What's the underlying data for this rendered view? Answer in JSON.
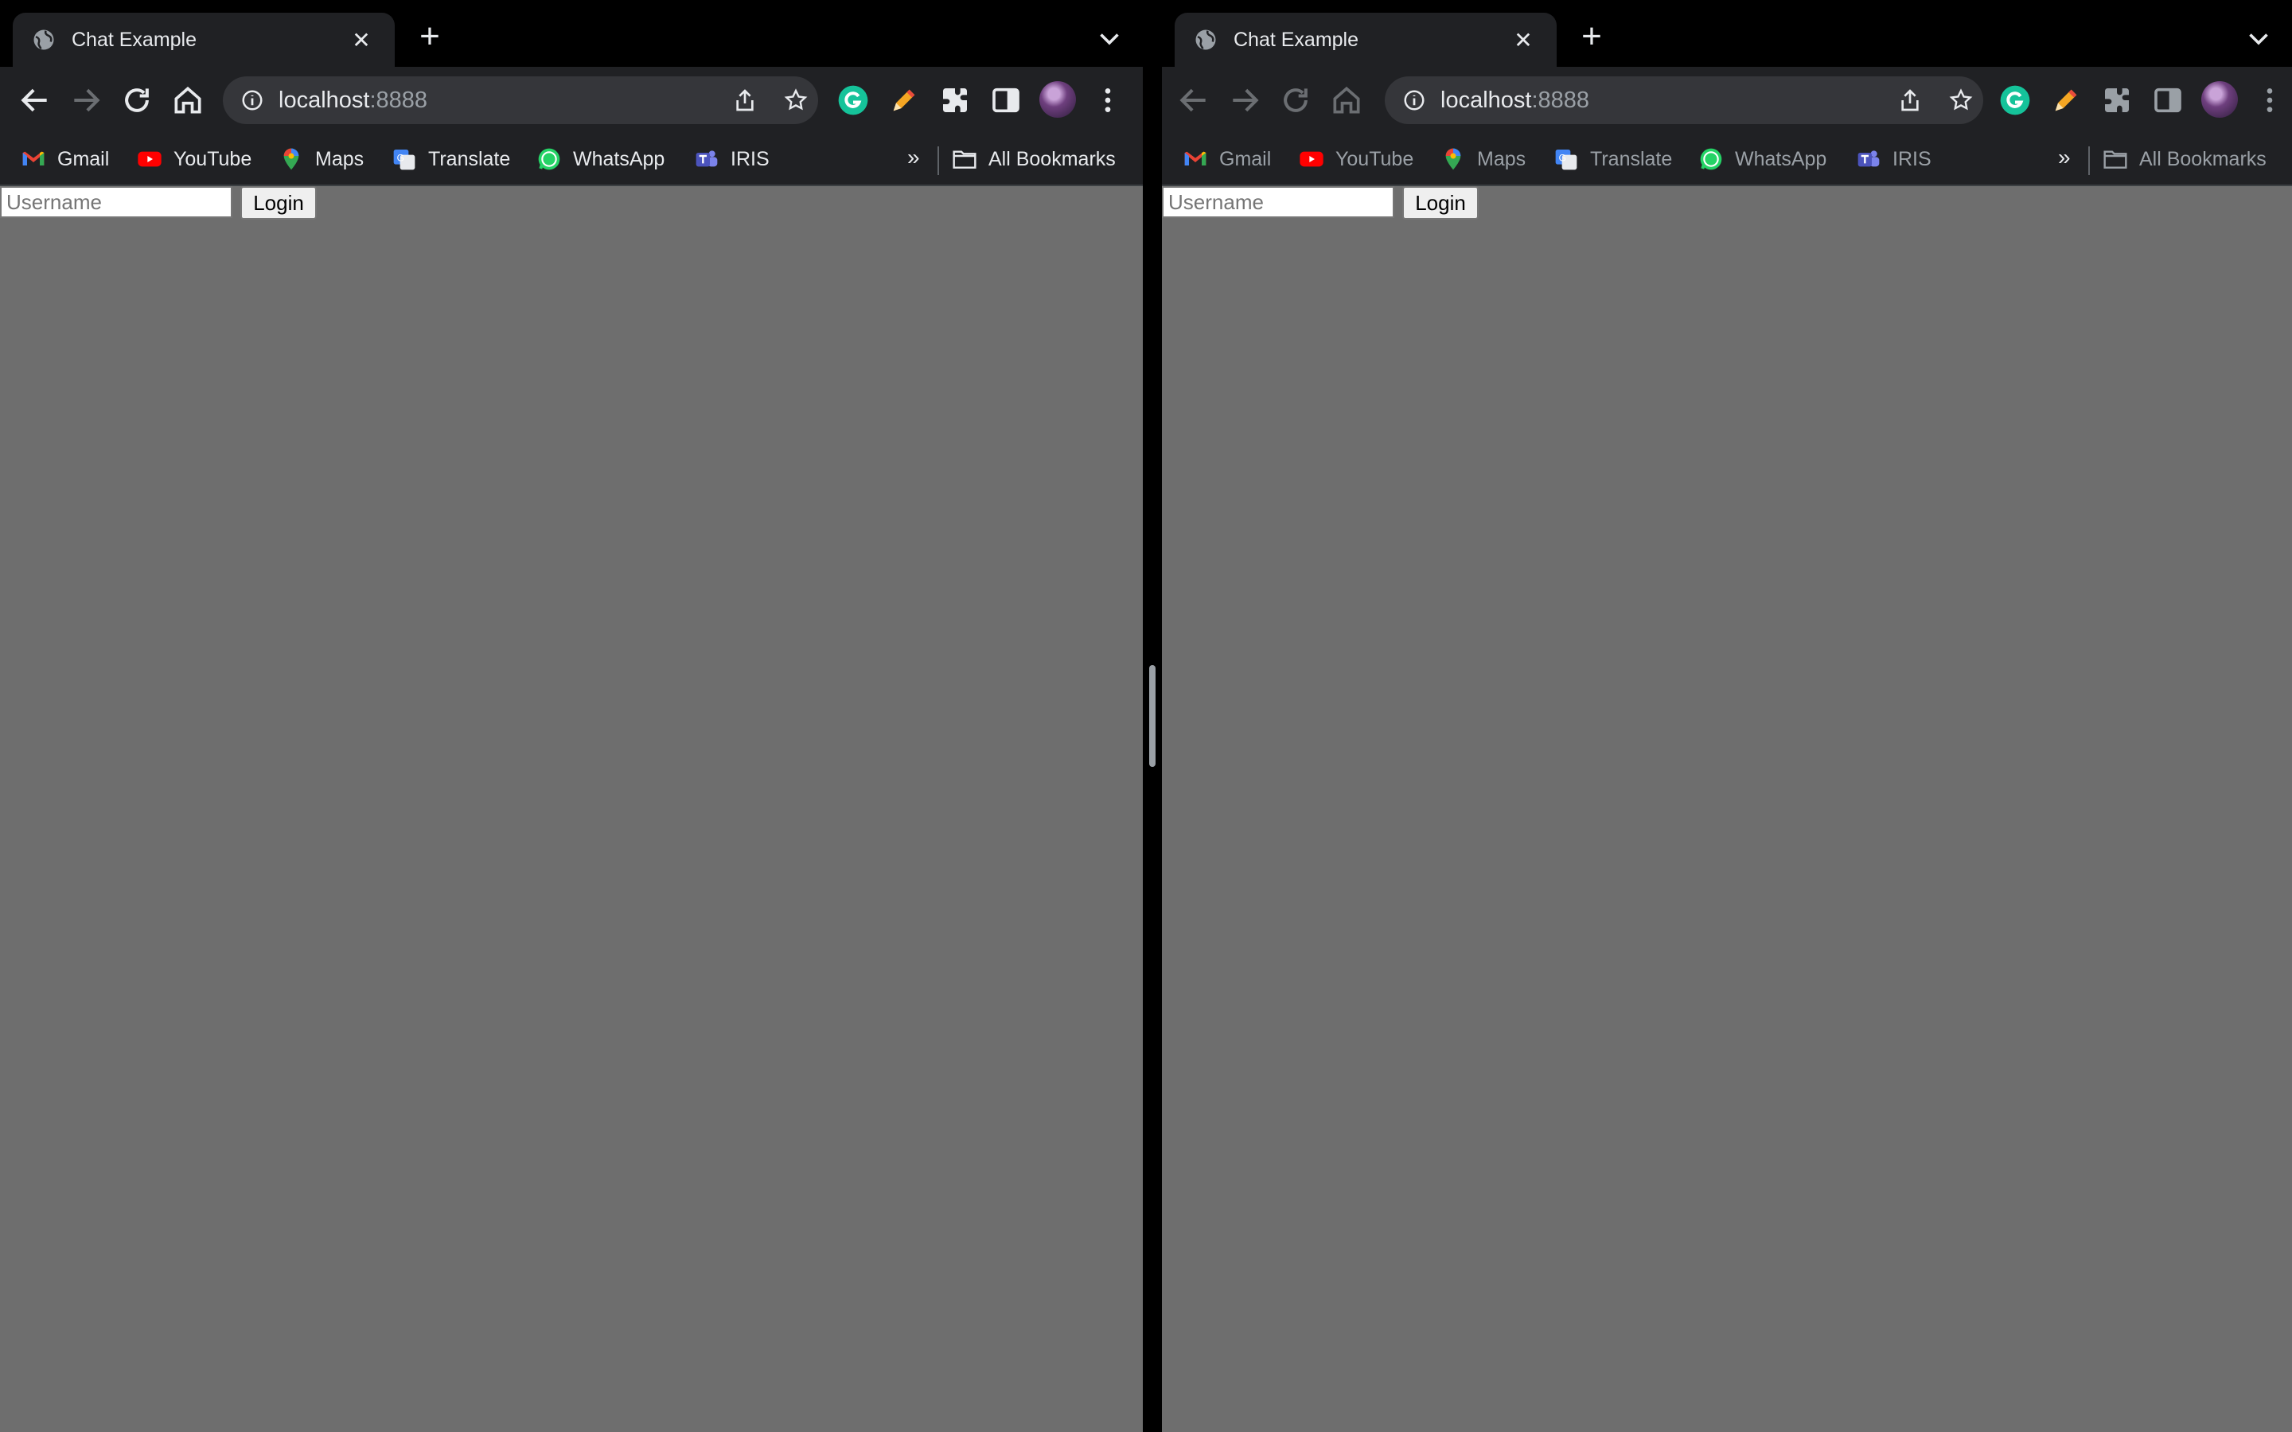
{
  "browser_windows": [
    {
      "id": "left",
      "tab": {
        "title": "Chat Example"
      },
      "address_bar": {
        "host": "localhost",
        "port": ":8888"
      },
      "bookmarks": [
        {
          "label": "Gmail",
          "icon": "gmail-icon"
        },
        {
          "label": "YouTube",
          "icon": "youtube-icon"
        },
        {
          "label": "Maps",
          "icon": "maps-icon"
        },
        {
          "label": "Translate",
          "icon": "translate-icon"
        },
        {
          "label": "WhatsApp",
          "icon": "whatsapp-icon"
        },
        {
          "label": "IRIS",
          "icon": "teams-icon"
        }
      ],
      "bookmarks_overflow": "»",
      "all_bookmarks": "All Bookmarks",
      "page": {
        "username_placeholder": "Username",
        "login_label": "Login"
      }
    },
    {
      "id": "right",
      "tab": {
        "title": "Chat Example"
      },
      "address_bar": {
        "host": "localhost",
        "port": ":8888"
      },
      "bookmarks": [
        {
          "label": "Gmail",
          "icon": "gmail-icon"
        },
        {
          "label": "YouTube",
          "icon": "youtube-icon"
        },
        {
          "label": "Maps",
          "icon": "maps-icon"
        },
        {
          "label": "Translate",
          "icon": "translate-icon"
        },
        {
          "label": "WhatsApp",
          "icon": "whatsapp-icon"
        },
        {
          "label": "IRIS",
          "icon": "teams-icon"
        }
      ],
      "bookmarks_overflow": "»",
      "all_bookmarks": "All Bookmarks",
      "page": {
        "username_placeholder": "Username",
        "login_label": "Login"
      }
    }
  ],
  "colors": {
    "tabstrip": "#000000",
    "toolbar": "#202124",
    "omnibox": "#35363a",
    "page_background": "#6e6e6e"
  }
}
